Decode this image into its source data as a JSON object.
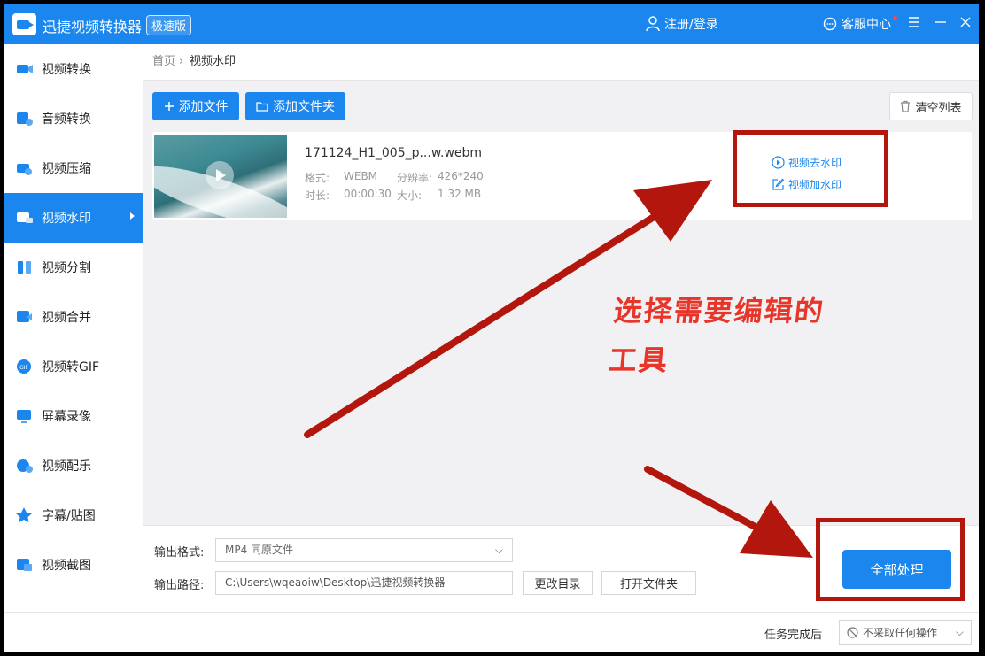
{
  "app": {
    "title": "迅捷视频转换器",
    "edition": "极速版"
  },
  "header": {
    "login": "注册/登录",
    "service": "客服中心"
  },
  "sidebar": {
    "items": [
      {
        "label": "视频转换",
        "icon": "video-convert-icon"
      },
      {
        "label": "音频转换",
        "icon": "audio-convert-icon"
      },
      {
        "label": "视频压缩",
        "icon": "video-compress-icon"
      },
      {
        "label": "视频水印",
        "icon": "video-watermark-icon",
        "active": true
      },
      {
        "label": "视频分割",
        "icon": "video-split-icon"
      },
      {
        "label": "视频合并",
        "icon": "video-merge-icon"
      },
      {
        "label": "视频转GIF",
        "icon": "gif-icon"
      },
      {
        "label": "屏幕录像",
        "icon": "screen-record-icon"
      },
      {
        "label": "视频配乐",
        "icon": "music-icon"
      },
      {
        "label": "字幕/贴图",
        "icon": "subtitle-icon"
      },
      {
        "label": "视频截图",
        "icon": "screenshot-icon"
      }
    ]
  },
  "breadcrumb": {
    "home": "首页",
    "separator": "›",
    "current": "视频水印"
  },
  "toolbar": {
    "add_file": "添加文件",
    "add_folder": "添加文件夹",
    "clear_list": "清空列表"
  },
  "file": {
    "name": "171124_H1_005_p...w.webm",
    "format_label": "格式:",
    "format": "WEBM",
    "resolution_label": "分辨率:",
    "resolution": "426*240",
    "duration_label": "时长:",
    "duration": "00:00:30",
    "size_label": "大小:",
    "size": "1.32 MB",
    "actions": {
      "remove_watermark": "视频去水印",
      "add_watermark": "视频加水印"
    }
  },
  "annotation": {
    "line1": "选择需要编辑的",
    "line2": "工具"
  },
  "output": {
    "format_label": "输出格式:",
    "format_value": "MP4  同原文件",
    "path_label": "输出路径:",
    "path_value": "C:\\Users\\wqeaoiw\\Desktop\\迅捷视频转换器",
    "change_dir": "更改目录",
    "open_folder": "打开文件夹",
    "process_all": "全部处理"
  },
  "status": {
    "after_label": "任务完成后",
    "after_value": "不采取任何操作"
  },
  "colors": {
    "accent": "#1a86ee",
    "annotation_red": "#b3160c",
    "annotation_text": "#e8352a"
  }
}
